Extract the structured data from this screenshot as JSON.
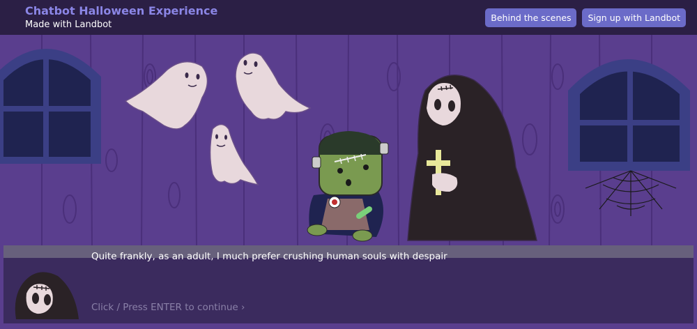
{
  "header": {
    "title": "Chatbot Halloween Experience",
    "subtitle": "Made with Landbot",
    "buttons": [
      {
        "label": "Behind the scenes"
      },
      {
        "label": "Sign up with Landbot"
      }
    ]
  },
  "dialog": {
    "message": "Quite frankly, as an adult, I much prefer crushing human souls with despair",
    "continue_prompt": "Click / Press ENTER to continue ›"
  },
  "colors": {
    "background": "#5a3e8e",
    "header": "#2b1f45",
    "accent": "#6b6bc8",
    "dialog": "#3b2b5e"
  }
}
